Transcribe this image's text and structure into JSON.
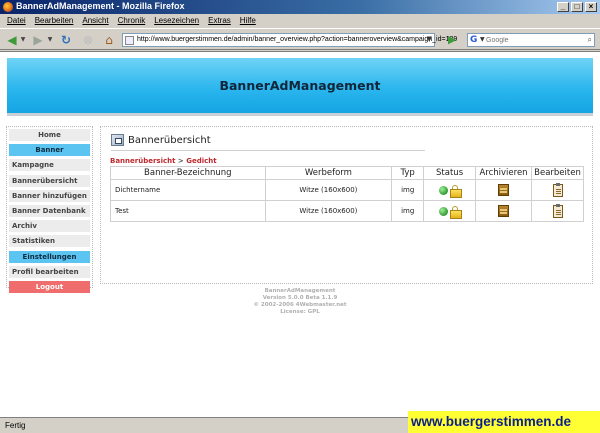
{
  "window": {
    "title": "BannerAdManagement - Mozilla Firefox"
  },
  "menu": [
    "Datei",
    "Bearbeiten",
    "Ansicht",
    "Chronik",
    "Lesezeichen",
    "Extras",
    "Hilfe"
  ],
  "browser": {
    "url": "http://www.buergerstimmen.de/admin/banner_overview.php?action=banneroverview&campaign_id=129",
    "search_placeholder": "Google"
  },
  "site": {
    "title": "BannerAdManagement"
  },
  "sidebar": {
    "items": [
      "Home",
      "Banner",
      "Kampagne",
      "Bannerübersicht",
      "Banner hinzufügen",
      "Banner Datenbank",
      "Archiv",
      "Statistiken",
      "Einstellungen",
      "Profil bearbeiten",
      "Logout"
    ]
  },
  "panel": {
    "title": "Bannerübersicht",
    "breadcrumb": {
      "first": "Bannerübersicht",
      "sep": ">",
      "second": "Gedicht"
    }
  },
  "table": {
    "headers": [
      "Banner-Bezeichnung",
      "Werbeform",
      "Typ",
      "Status",
      "Archivieren",
      "Bearbeiten"
    ],
    "rows": [
      {
        "name": "Dichtername",
        "format": "Witze (160x600)",
        "type": "img",
        "status_icon": "green-dot-icon",
        "archive_icon": "archive-icon",
        "edit_icon": "edit-icon"
      },
      {
        "name": "Test",
        "format": "Witze (160x600)",
        "type": "img",
        "status_icon": "green-dot-icon",
        "archive_icon": "archive-icon",
        "edit_icon": "edit-icon"
      }
    ]
  },
  "footer": {
    "line1": "BannerAdManagement",
    "line2": "Version 5.0.0 Beta 1.1.9",
    "line3": "© 2002-2006 4Webmaster.net",
    "line4": "License: GPL"
  },
  "status": {
    "text": "Fertig"
  },
  "watermark": {
    "text": "www.buergerstimmen.de"
  },
  "colors": {
    "banner": "#2bb6ee",
    "sidebar_head": "#5cc4f1",
    "logout": "#ef6d6d",
    "breadcrumb": "#c0282d"
  }
}
